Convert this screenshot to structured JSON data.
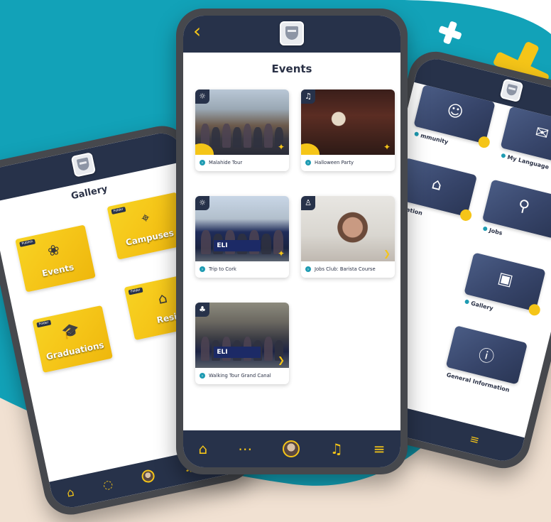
{
  "colors": {
    "accent": "#f5c518",
    "brand_navy": "#27324a",
    "teal_background": "#12a2b8",
    "sand": "#f1e1d2",
    "status_dot": "#1e9bb2"
  },
  "center_phone": {
    "back_icon": "chevron-left-icon",
    "title": "Events",
    "events": [
      {
        "label": "Malahide Tour",
        "corner_icon": "sun-icon"
      },
      {
        "label": "Halloween Party",
        "corner_icon": "music-note-icon"
      },
      {
        "label": "Trip to Cork",
        "corner_icon": "sun-icon"
      },
      {
        "label": "Jobs Club: Barista Course",
        "corner_icon": "badge-icon"
      },
      {
        "label": "Walking Tour Grand Canal",
        "corner_icon": "tree-icon"
      }
    ],
    "banner_text": "ELI",
    "nav": [
      "home-icon",
      "chat-icon",
      "profile-avatar",
      "bell-icon",
      "menu-icon"
    ]
  },
  "left_phone": {
    "title": "Gallery",
    "folders": [
      {
        "tag": "Publish",
        "name": "Events"
      },
      {
        "tag": "Folder",
        "name": "Campuses"
      },
      {
        "tag": "Folder",
        "name": "Graduations"
      },
      {
        "tag": "Folder",
        "name": "Resi"
      }
    ]
  },
  "right_phone": {
    "tiles": [
      {
        "label": "mmunity"
      },
      {
        "label": "My Language Group"
      },
      {
        "label": "dation"
      },
      {
        "label": "Jobs"
      },
      {
        "label": "Gallery"
      },
      {
        "label": "General Information"
      }
    ]
  }
}
